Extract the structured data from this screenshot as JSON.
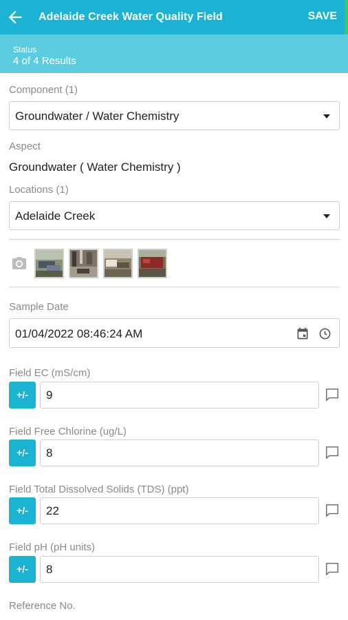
{
  "header": {
    "title": "Adelaide Creek Water Quality Field",
    "save_label": "SAVE"
  },
  "status": {
    "label": "Status",
    "value": "4 of 4 Results"
  },
  "component": {
    "label": "Component (1)",
    "value": "Groundwater / Water Chemistry"
  },
  "aspect": {
    "label": "Aspect",
    "value": "Groundwater ( Water Chemistry )"
  },
  "locations": {
    "label": "Locations (1)",
    "value": "Adelaide Creek"
  },
  "sample_date": {
    "label": "Sample Date",
    "value": "01/04/2022 08:46:24 AM"
  },
  "fields": [
    {
      "label": "Field EC (mS/cm)",
      "toggle": "+/-",
      "value": "9"
    },
    {
      "label": "Field Free Chlorine (ug/L)",
      "toggle": "+/-",
      "value": "8"
    },
    {
      "label": "Field Total Dissolved Solids (TDS) (ppt)",
      "toggle": "+/-",
      "value": "22"
    },
    {
      "label": "Field pH (pH units)",
      "toggle": "+/-",
      "value": "8"
    }
  ],
  "reference": {
    "label": "Reference No."
  },
  "colors": {
    "primary": "#1ab3d4",
    "status_bar": "#5ccde0",
    "accent": "#3ec46d"
  }
}
